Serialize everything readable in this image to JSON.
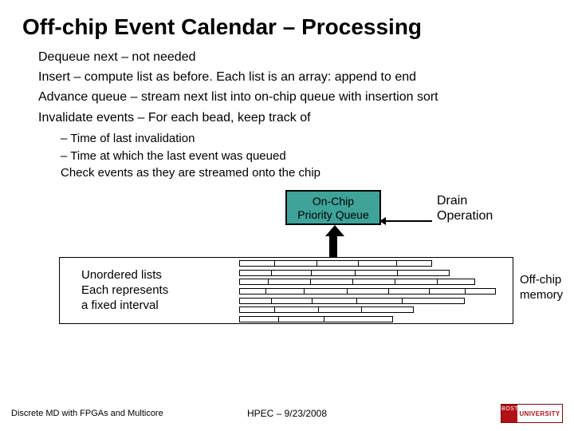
{
  "title": "Off-chip Event Calendar – Processing",
  "bullets": [
    "Dequeue next – not needed",
    "Insert – compute list as before.  Each list is an array:  append to end",
    "Advance queue – stream next list into on-chip queue with insertion sort",
    "Invalidate events – For each bead, keep track of"
  ],
  "sub": [
    "Time of last invalidation",
    "Time at which the last event was queued",
    "Check events as they are streamed onto the chip"
  ],
  "diagram": {
    "pq": "On-Chip\nPriority Queue",
    "drain": "Drain\nOperation",
    "left_note": "Unordered lists\nEach represents\na fixed interval",
    "right_note": "Off-chip\nmemory"
  },
  "footer": {
    "left": "Discrete MD with FPGAs and Multicore",
    "center": "HPEC  –  9/23/2008",
    "logo_word": "BOSTON",
    "logo_sub": "UNIVERSITY"
  }
}
